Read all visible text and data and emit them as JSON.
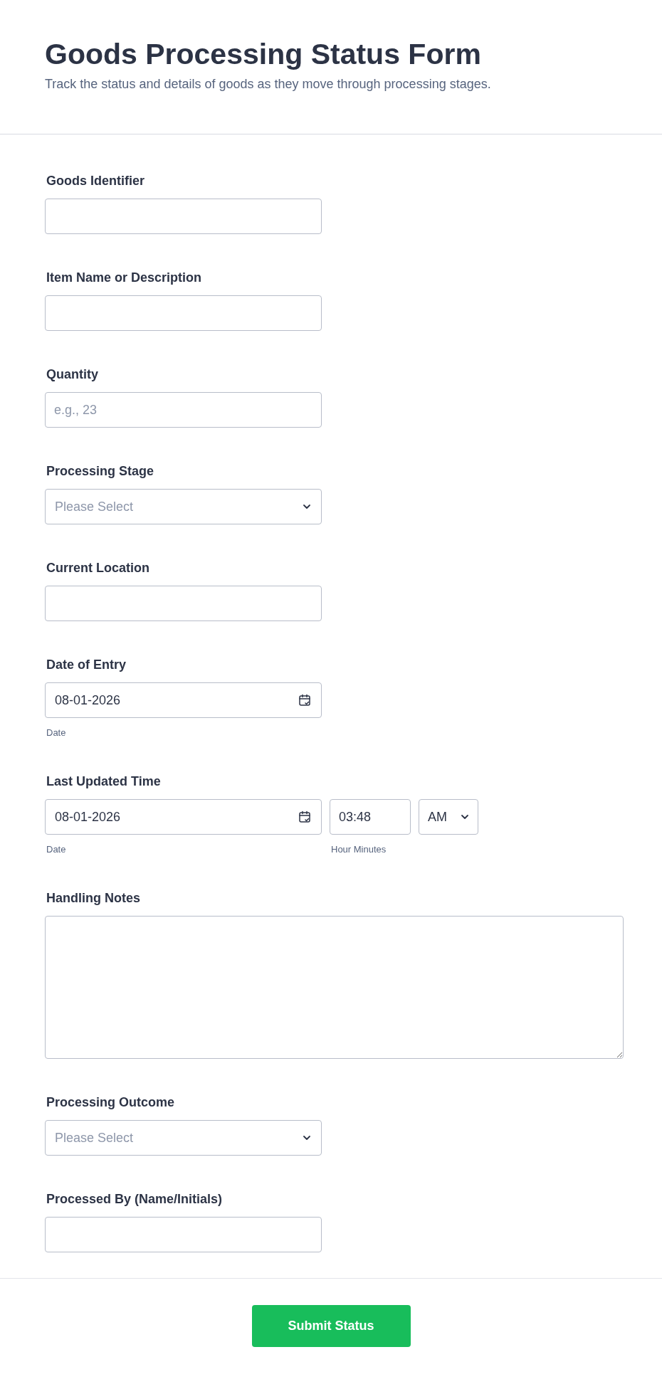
{
  "header": {
    "title": "Goods Processing Status Form",
    "subtitle": "Track the status and details of goods as they move through processing stages."
  },
  "fields": [
    {
      "kind": "text",
      "label": "Goods Identifier"
    },
    {
      "kind": "text",
      "label": "Item Name or Description"
    },
    {
      "kind": "text",
      "label": "Quantity",
      "placeholder": "e.g., 23"
    },
    {
      "kind": "select",
      "label": "Processing Stage",
      "placeholder": "Please Select"
    },
    {
      "kind": "text",
      "label": "Current Location"
    },
    {
      "kind": "date",
      "label": "Date of Entry",
      "value": "08-01-2026",
      "sublabel": "Date"
    },
    {
      "kind": "datetime",
      "label": "Last Updated Time",
      "value": "08-01-2026",
      "sublabel": "Date",
      "time": "03:48",
      "time_sublabel": "Hour Minutes",
      "ampm": "AM"
    },
    {
      "kind": "textarea",
      "label": "Handling Notes"
    },
    {
      "kind": "select",
      "label": "Processing Outcome",
      "placeholder": "Please Select"
    },
    {
      "kind": "text",
      "label": "Processed By (Name/Initials)"
    }
  ],
  "submit_button": "Submit Status"
}
